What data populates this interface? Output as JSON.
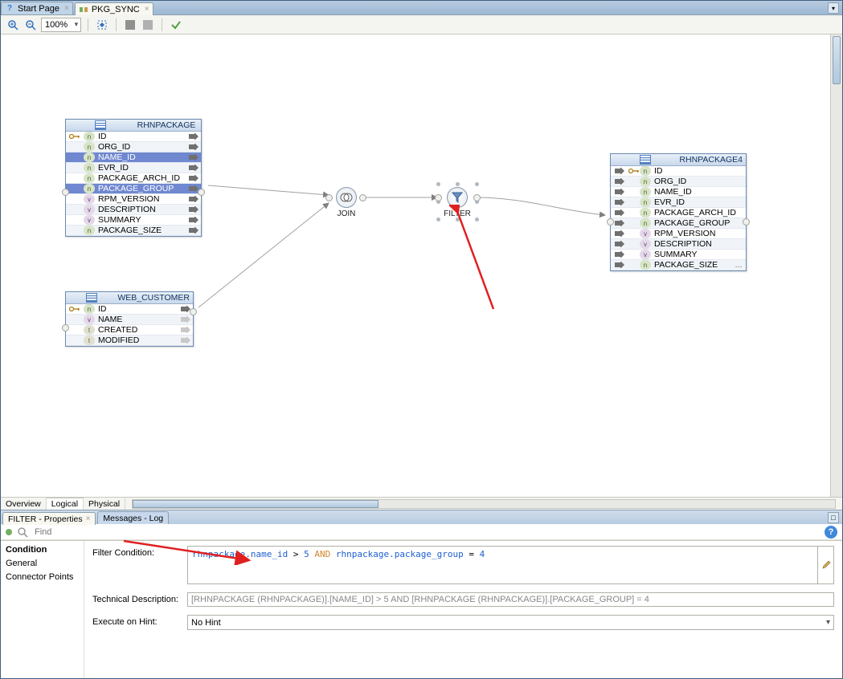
{
  "tabs": {
    "start": "Start Page",
    "current": "PKG_SYNC"
  },
  "toolbar": {
    "zoom": "100%"
  },
  "canvas": {
    "rhnpackage": {
      "title": "RHNPACKAGE",
      "rows": [
        {
          "t": "n",
          "label": "ID",
          "key": true
        },
        {
          "t": "n",
          "label": "ORG_ID"
        },
        {
          "t": "n",
          "label": "NAME_ID",
          "sel": true
        },
        {
          "t": "n",
          "label": "EVR_ID"
        },
        {
          "t": "n",
          "label": "PACKAGE_ARCH_ID"
        },
        {
          "t": "n",
          "label": "PACKAGE_GROUP",
          "sel": true
        },
        {
          "t": "v",
          "label": "RPM_VERSION"
        },
        {
          "t": "v",
          "label": "DESCRIPTION"
        },
        {
          "t": "v",
          "label": "SUMMARY"
        },
        {
          "t": "n",
          "label": "PACKAGE_SIZE"
        }
      ]
    },
    "webcustomer": {
      "title": "WEB_CUSTOMER",
      "rows": [
        {
          "t": "n",
          "label": "ID",
          "key": true
        },
        {
          "t": "v",
          "label": "NAME"
        },
        {
          "t": "t",
          "label": "CREATED"
        },
        {
          "t": "t",
          "label": "MODIFIED"
        }
      ]
    },
    "rhnpackage4": {
      "title": "RHNPACKAGE4",
      "rows": [
        {
          "t": "n",
          "label": "ID",
          "key": true
        },
        {
          "t": "n",
          "label": "ORG_ID"
        },
        {
          "t": "n",
          "label": "NAME_ID"
        },
        {
          "t": "n",
          "label": "EVR_ID"
        },
        {
          "t": "n",
          "label": "PACKAGE_ARCH_ID"
        },
        {
          "t": "n",
          "label": "PACKAGE_GROUP"
        },
        {
          "t": "v",
          "label": "RPM_VERSION"
        },
        {
          "t": "v",
          "label": "DESCRIPTION"
        },
        {
          "t": "v",
          "label": "SUMMARY"
        },
        {
          "t": "n",
          "label": "PACKAGE_SIZE"
        }
      ],
      "more": "..."
    },
    "join_label": "JOIN",
    "filter_label": "FILTER"
  },
  "view_tabs": {
    "overview": "Overview",
    "logical": "Logical",
    "physical": "Physical"
  },
  "panel_tabs": {
    "filter_props": "FILTER - Properties",
    "messages": "Messages - Log"
  },
  "find": {
    "placeholder": "Find"
  },
  "props": {
    "cats": {
      "condition": "Condition",
      "general": "General",
      "connector": "Connector Points"
    },
    "filter_condition_label": "Filter Condition:",
    "tech_desc_label": "Technical Description:",
    "tech_desc_value": "[RHNPACKAGE (RHNPACKAGE)].[NAME_ID] > 5 AND [RHNPACKAGE (RHNPACKAGE)].[PACKAGE_GROUP] = 4",
    "exec_hint_label": "Execute on Hint:",
    "exec_hint_value": "No Hint",
    "code": {
      "a": "rhnpackage.name_id",
      "op1": " > ",
      "n1": "5",
      "and": " AND ",
      "b": "rhnpackage.package_group",
      "op2": " = ",
      "n2": "4"
    }
  }
}
